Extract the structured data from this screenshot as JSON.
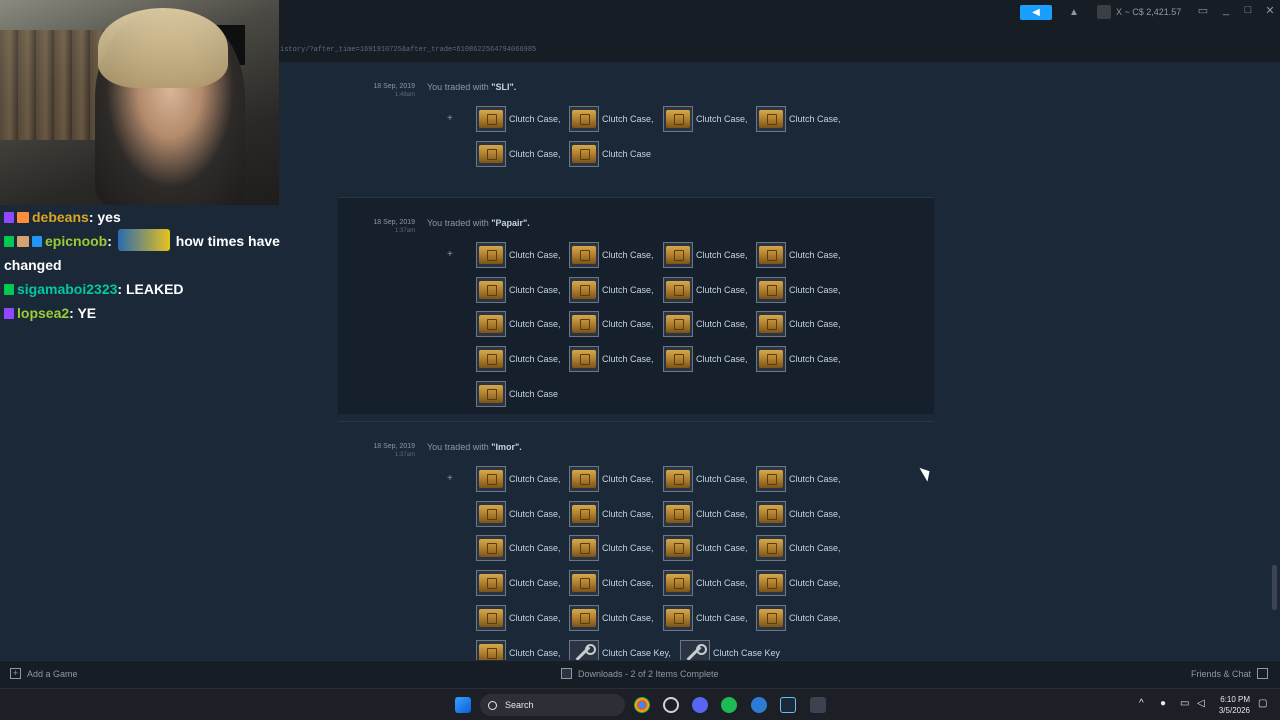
{
  "browser": {
    "url": "istory/?after_time=1691910725&after_trade=6108622564794066985"
  },
  "header": {
    "announcement_icon": "megaphone-icon",
    "bell_icon": "bell-icon",
    "user_label": "X ~ C$ 2,421.57"
  },
  "window_controls": [
    "_",
    "□",
    "✕"
  ],
  "trades": [
    {
      "date": "18 Sep, 2019",
      "time": "1:48am",
      "prefix": "You traded with",
      "partner": "\"SLI\".",
      "items": [
        "Clutch Case,",
        "Clutch Case,",
        "Clutch Case,",
        "Clutch Case,",
        "Clutch Case,",
        "Clutch Case"
      ],
      "item_types": [
        "case",
        "case",
        "case",
        "case",
        "case",
        "case"
      ]
    },
    {
      "date": "18 Sep, 2019",
      "time": "1:37am",
      "prefix": "You traded with",
      "partner": "\"Papair\".",
      "items": [
        "Clutch Case,",
        "Clutch Case,",
        "Clutch Case,",
        "Clutch Case,",
        "Clutch Case,",
        "Clutch Case,",
        "Clutch Case,",
        "Clutch Case,",
        "Clutch Case,",
        "Clutch Case,",
        "Clutch Case,",
        "Clutch Case,",
        "Clutch Case,",
        "Clutch Case,",
        "Clutch Case,",
        "Clutch Case,",
        "Clutch Case"
      ],
      "item_types": [
        "case",
        "case",
        "case",
        "case",
        "case",
        "case",
        "case",
        "case",
        "case",
        "case",
        "case",
        "case",
        "case",
        "case",
        "case",
        "case",
        "case"
      ]
    },
    {
      "date": "18 Sep, 2019",
      "time": "1:37am",
      "prefix": "You traded with",
      "partner": "\"Imor\".",
      "items": [
        "Clutch Case,",
        "Clutch Case,",
        "Clutch Case,",
        "Clutch Case,",
        "Clutch Case,",
        "Clutch Case,",
        "Clutch Case,",
        "Clutch Case,",
        "Clutch Case,",
        "Clutch Case,",
        "Clutch Case,",
        "Clutch Case,",
        "Clutch Case,",
        "Clutch Case,",
        "Clutch Case,",
        "Clutch Case,",
        "Clutch Case,",
        "Clutch Case,",
        "Clutch Case,",
        "Clutch Case,",
        "Clutch Case,",
        "Clutch Case Key,",
        "Clutch Case Key"
      ],
      "item_types": [
        "case",
        "case",
        "case",
        "case",
        "case",
        "case",
        "case",
        "case",
        "case",
        "case",
        "case",
        "case",
        "case",
        "case",
        "case",
        "case",
        "case",
        "case",
        "case",
        "case",
        "case",
        "key",
        "key"
      ]
    }
  ],
  "chat": [
    {
      "user": "debeans",
      "message": "yes",
      "color": "#daa520"
    },
    {
      "user": "epicnoob",
      "message": "how times have changed",
      "color": "#9acd32",
      "emote": true
    },
    {
      "user": "sigamaboi2323",
      "message": "LEAKED",
      "color": "#00c8a0"
    },
    {
      "user": "lopsea2",
      "message": "YE",
      "color": "#9acd32"
    }
  ],
  "bottombar": {
    "add_game": "Add a Game",
    "downloads": "Downloads - 2 of 2 Items Complete",
    "friends": "Friends & Chat"
  },
  "taskbar": {
    "search": "Search",
    "time": "6:10 PM",
    "date": "3/5/2026"
  }
}
